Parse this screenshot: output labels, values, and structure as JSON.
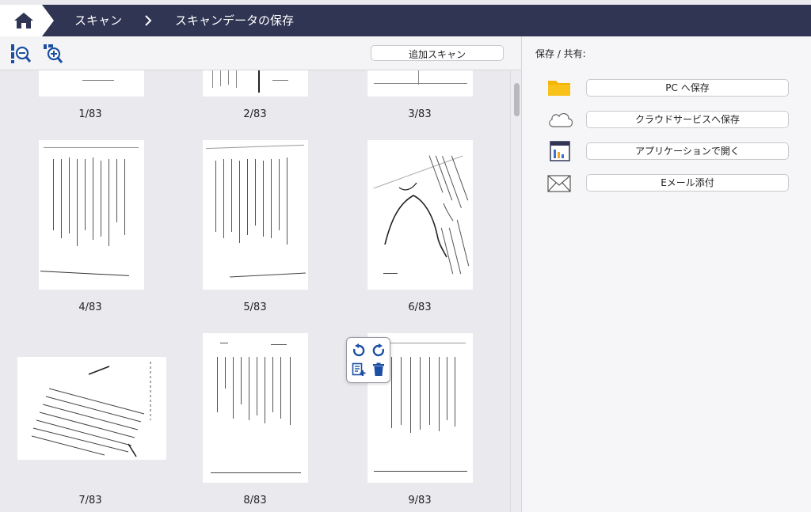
{
  "breadcrumb": {
    "items": [
      "スキャン",
      "スキャンデータの保存"
    ]
  },
  "toolbar": {
    "add_scan_label": "追加スキャン",
    "icons": [
      "zoom-out-icon",
      "zoom-in-icon"
    ]
  },
  "pages": [
    {
      "label": "1/83"
    },
    {
      "label": "2/83"
    },
    {
      "label": "3/83"
    },
    {
      "label": "4/83"
    },
    {
      "label": "5/83"
    },
    {
      "label": "6/83"
    },
    {
      "label": "7/83"
    },
    {
      "label": "8/83"
    },
    {
      "label": "9/83"
    }
  ],
  "popover": {
    "icons": [
      "rotate-left-icon",
      "rotate-right-icon",
      "add-page-icon",
      "trash-icon"
    ]
  },
  "share": {
    "title": "保存 / 共有:",
    "buttons": [
      {
        "label": "PC へ保存",
        "icon": "folder-icon"
      },
      {
        "label": "クラウドサービスへ保存",
        "icon": "cloud-icon"
      },
      {
        "label": "アプリケーションで開く",
        "icon": "application-icon"
      },
      {
        "label": "Eメール添付",
        "icon": "envelope-icon"
      }
    ]
  },
  "colors": {
    "topbar": "#2f3552",
    "folder": "#f5b400",
    "icon_blue": "#1c4fa3"
  }
}
